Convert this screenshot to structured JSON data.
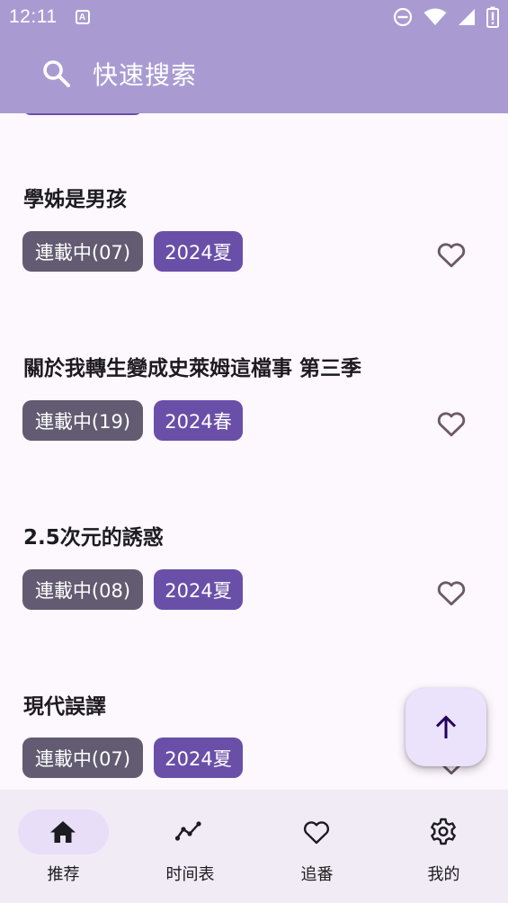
{
  "status_bar": {
    "time": "12:11",
    "notification_glyph": "A"
  },
  "search": {
    "placeholder": "快速搜索"
  },
  "anime_list": [
    {
      "title": "學姊是男孩",
      "status": "連載中(07)",
      "season": "2024夏"
    },
    {
      "title": "關於我轉生變成史萊姆這檔事 第三季",
      "status": "連載中(19)",
      "season": "2024春"
    },
    {
      "title": "2.5次元的誘惑",
      "status": "連載中(08)",
      "season": "2024夏"
    },
    {
      "title": "現代誤譯",
      "status": "連載中(07)",
      "season": "2024夏"
    }
  ],
  "bottom_nav": {
    "items": [
      {
        "label": "推荐",
        "icon": "home-icon",
        "selected": true
      },
      {
        "label": "时间表",
        "icon": "timeline-icon",
        "selected": false
      },
      {
        "label": "追番",
        "icon": "heart-icon",
        "selected": false
      },
      {
        "label": "我的",
        "icon": "gear-icon",
        "selected": false
      }
    ]
  },
  "colors": {
    "header_bg": "#a99bd2",
    "page_bg": "#fdf7fe",
    "status_chip": "#625b71",
    "season_chip": "#6a4fa8",
    "fab_bg": "#ebe2fb",
    "nav_bg": "#f1ebf5",
    "nav_selected_pill": "#e8def8"
  }
}
